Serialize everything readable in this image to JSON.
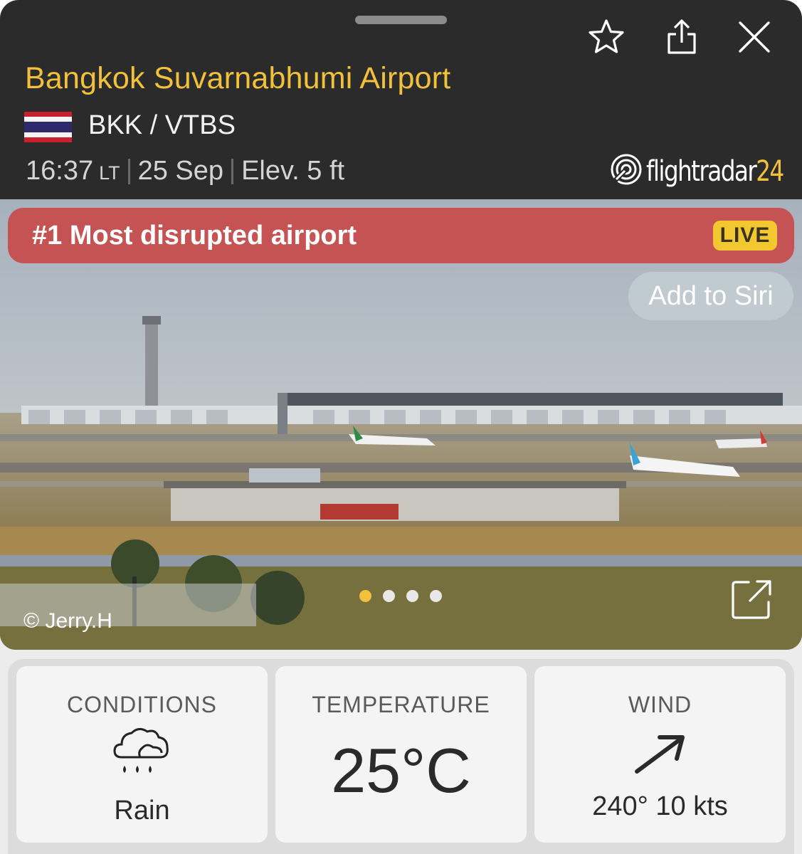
{
  "header": {
    "airport_name": "Bangkok Suvarnabhumi Airport",
    "codes": "BKK / VTBS",
    "time": "16:37",
    "time_suffix": "LT",
    "date": "25 Sep",
    "elevation": "Elev. 5 ft",
    "brand_main": "flightradar",
    "brand_num": "24",
    "flag_icon": "thailand-flag-icon",
    "actions": [
      "star-icon",
      "share-icon",
      "close-icon"
    ]
  },
  "photo": {
    "banner_text": "#1 Most disrupted airport",
    "live_label": "LIVE",
    "siri_label": "Add to Siri",
    "credit": "© Jerry.H",
    "pages": 4,
    "active_page": 1
  },
  "weather": {
    "conditions": {
      "label": "CONDITIONS",
      "value": "Rain",
      "icon": "rain-cloud-icon"
    },
    "temperature": {
      "label": "TEMPERATURE",
      "value": "25°C"
    },
    "wind": {
      "label": "WIND",
      "value": "240° 10 kts",
      "icon": "wind-arrow-icon"
    }
  },
  "colors": {
    "accent": "#f2c13b",
    "header_bg": "#2b2b2b",
    "banner": "#c65353",
    "live_badge": "#f2c730"
  }
}
